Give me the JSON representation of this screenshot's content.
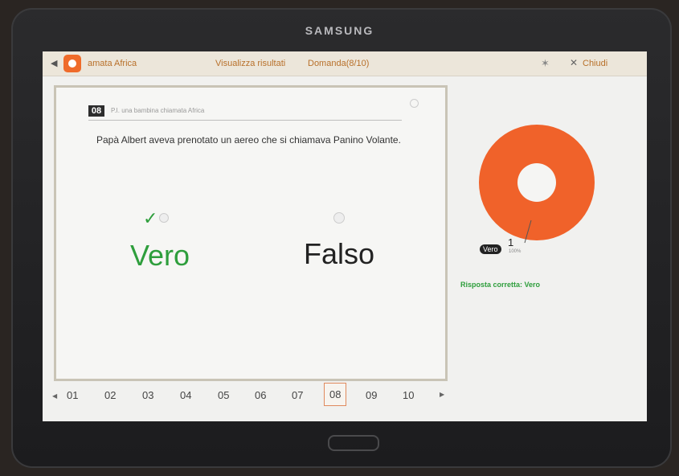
{
  "device": {
    "brand": "SAMSUNG"
  },
  "actionbar": {
    "title": "amata Africa",
    "view_results": "Visualizza risultati",
    "question_counter": "Domanda(8/10)",
    "close_label": "Chiudi"
  },
  "question": {
    "number": "08",
    "subtitle": "P.I. una bambina chiamata Africa",
    "text": "Papà Albert aveva prenotato un aereo che si chiamava Panino Volante.",
    "options": [
      {
        "label": "Vero",
        "selected": true,
        "correct": true
      },
      {
        "label": "Falso",
        "selected": false,
        "correct": false
      }
    ]
  },
  "pager": {
    "pages": [
      "01",
      "02",
      "03",
      "04",
      "05",
      "06",
      "07",
      "08",
      "09",
      "10"
    ],
    "active": "08"
  },
  "chart_data": {
    "type": "pie",
    "categories": [
      "Vero"
    ],
    "values": [
      1
    ],
    "labels": [
      {
        "name": "Vero",
        "count": "1",
        "percent": "100%"
      }
    ],
    "colors": {
      "Vero": "#f0622a"
    }
  },
  "result": {
    "correct_answer": "Risposta corretta: Vero"
  },
  "colors": {
    "accent": "#ef6b2a",
    "correct": "#2e9e3c"
  }
}
